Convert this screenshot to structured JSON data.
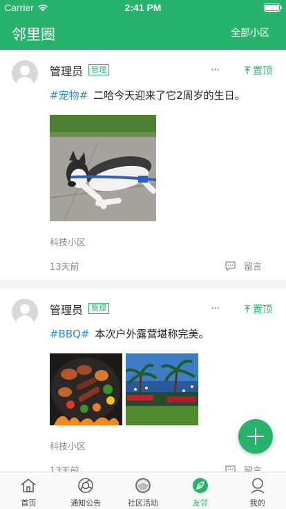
{
  "status_bar": {
    "carrier": "Carrier",
    "time": "2:41 PM"
  },
  "header": {
    "title": "邻里圈",
    "right_label": "全部小区"
  },
  "posts": [
    {
      "username": "管理员",
      "badge": "管理",
      "more": "···",
      "pin_label": "置顶",
      "tag": "#宠物#",
      "text": "二哈今天迎来了它2周岁的生日。",
      "community": "科技小区",
      "time_ago": "13天前",
      "comment_label": "留言"
    },
    {
      "username": "管理员",
      "badge": "管理",
      "more": "···",
      "pin_label": "置顶",
      "tag": "#BBQ#",
      "text": "本次户外露营堪称完美。",
      "community": "科技小区",
      "time_ago": "13天前",
      "comment_label": "留言"
    }
  ],
  "tabbar": {
    "items": [
      {
        "label": "首页",
        "icon": "home-icon"
      },
      {
        "label": "通知公告",
        "icon": "notice-icon"
      },
      {
        "label": "社区活动",
        "icon": "activity-icon"
      },
      {
        "label": "友邻",
        "icon": "neighbor-icon",
        "active": true
      },
      {
        "label": "我的",
        "icon": "profile-icon"
      }
    ]
  },
  "colors": {
    "primary": "#27b36b",
    "tag": "#2d8ecf"
  }
}
